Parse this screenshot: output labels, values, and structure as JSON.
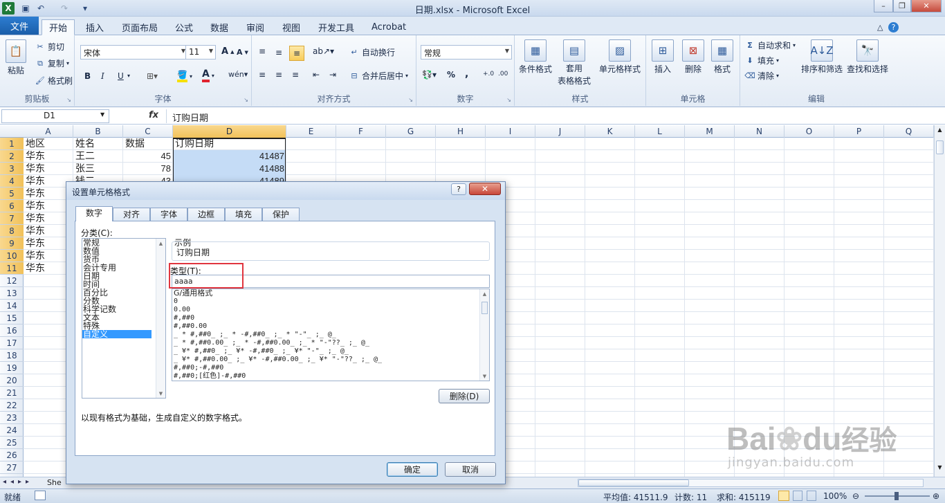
{
  "window": {
    "title": "日期.xlsx - Microsoft Excel"
  },
  "ribbon_tabs": [
    "开始",
    "插入",
    "页面布局",
    "公式",
    "数据",
    "审阅",
    "视图",
    "开发工具",
    "Acrobat"
  ],
  "file_tab": "文件",
  "ribbon": {
    "clipboard": {
      "paste": "粘贴",
      "cut": "剪切",
      "copy": "复制",
      "format_painter": "格式刷",
      "label": "剪贴板"
    },
    "font": {
      "name": "宋体",
      "size": "11",
      "label": "字体",
      "bold": "B",
      "italic": "I",
      "underline": "U"
    },
    "alignment": {
      "wrap": "自动换行",
      "merge": "合并后居中",
      "label": "对齐方式"
    },
    "number": {
      "format": "常规",
      "label": "数字",
      "percent": "%",
      "comma": ","
    },
    "styles": {
      "conditional": "条件格式",
      "table1": "套用",
      "table2": "表格格式",
      "cell_styles": "单元格样式",
      "label": "样式"
    },
    "cells": {
      "insert": "插入",
      "delete": "删除",
      "format": "格式",
      "label": "单元格"
    },
    "editing": {
      "autosum": "自动求和",
      "fill": "填充",
      "clear": "清除",
      "sort": "排序和筛选",
      "find": "查找和选择",
      "label": "编辑"
    }
  },
  "formula_bar": {
    "name_box": "D1",
    "fx": "fx",
    "content": "订购日期"
  },
  "columns": [
    "A",
    "B",
    "C",
    "D",
    "E",
    "F",
    "G",
    "H",
    "I",
    "J",
    "K",
    "L",
    "M",
    "N",
    "O",
    "P",
    "Q"
  ],
  "rows": [
    "1",
    "2",
    "3",
    "4",
    "5",
    "6",
    "7",
    "8",
    "9",
    "10",
    "11",
    "12",
    "13",
    "14",
    "15",
    "16",
    "17",
    "18",
    "19",
    "20",
    "21",
    "22",
    "23",
    "24",
    "25",
    "26",
    "27"
  ],
  "sheet": {
    "header": [
      "地区",
      "姓名",
      "数据",
      "订购日期"
    ],
    "row2": [
      "华东",
      "王二",
      "45",
      "41487"
    ],
    "row3": [
      "华东",
      "张三",
      "78",
      "41488"
    ],
    "region": [
      "华东",
      "华东",
      "华东",
      "华东",
      "华东",
      "华东",
      "华东",
      "华东"
    ],
    "row4_partial": "钱二",
    "row4_partial_c": "43",
    "row4_partial_d": "41489"
  },
  "sheet_tab": "She",
  "status": {
    "ready": "就绪",
    "average": "平均值: 41511.9",
    "count": "计数: 11",
    "sum": "求和: 415119",
    "zoom": "100%"
  },
  "dialog": {
    "title": "设置单元格格式",
    "help": "?",
    "tabs": [
      "数字",
      "对齐",
      "字体",
      "边框",
      "填充",
      "保护"
    ],
    "category_label": "分类(C):",
    "categories": [
      "常规",
      "数值",
      "货币",
      "会计专用",
      "日期",
      "时间",
      "百分比",
      "分数",
      "科学记数",
      "文本",
      "特殊",
      "自定义"
    ],
    "selected_category": "自定义",
    "sample_label": "示例",
    "sample_value": "订购日期",
    "type_label": "类型(T):",
    "type_value": "aaaa",
    "formats": [
      "G/通用格式",
      "0",
      "0.00",
      "#,##0",
      "#,##0.00",
      "_ * #,##0_ ;_ * -#,##0_ ;_ * \"-\"_ ;_ @_",
      "_ * #,##0.00_ ;_ * -#,##0.00_ ;_ * \"-\"??_ ;_ @_",
      "_ ¥* #,##0_ ;_ ¥* -#,##0_ ;_ ¥* \"-\"_ ;_ @_",
      "_ ¥* #,##0.00_ ;_ ¥* -#,##0.00_ ;_ ¥* \"-\"??_ ;_ @_",
      "#,##0;-#,##0",
      "#,##0;[红色]-#,##0"
    ],
    "delete_button": "删除(D)",
    "description": "以现有格式为基础，生成自定义的数字格式。",
    "ok_button": "确定",
    "cancel_button": "取消"
  },
  "watermark": {
    "brand": "Bai",
    "brand2": "du",
    "cn": "经验",
    "url": "jingyan.baidu.com"
  },
  "colors": {
    "accent": "#1a5ea9",
    "selection": "#c5dcf6",
    "header_sel": "#f1c15a",
    "red_box": "#e0353f"
  }
}
